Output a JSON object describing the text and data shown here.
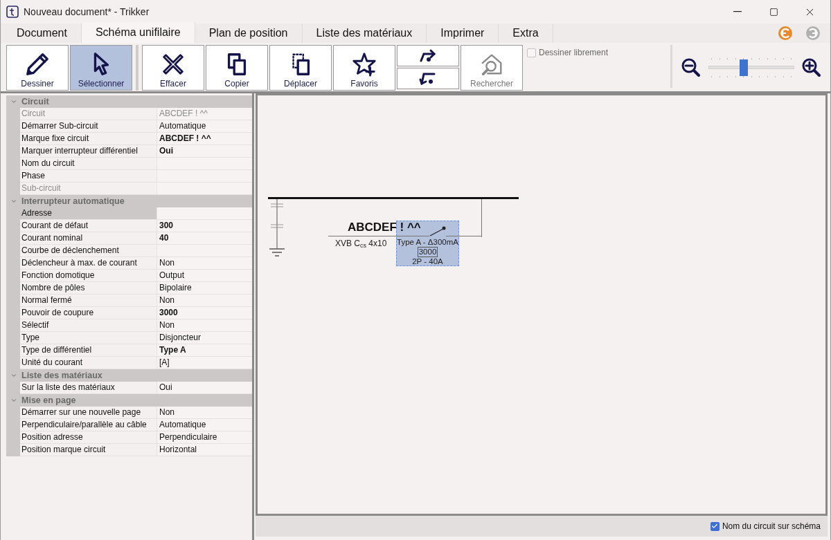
{
  "window": {
    "title": "Nouveau document* - Trikker"
  },
  "tabs": [
    {
      "label": "Document",
      "selected": false
    },
    {
      "label": "Schéma unifilaire",
      "selected": true
    },
    {
      "label": "Plan de position",
      "selected": false
    },
    {
      "label": "Liste des matériaux",
      "selected": false
    },
    {
      "label": "Imprimer",
      "selected": false
    },
    {
      "label": "Extra",
      "selected": false
    }
  ],
  "history": [
    {
      "kind": "undo",
      "disabled": false
    },
    {
      "kind": "redo",
      "disabled": true
    }
  ],
  "toolbar": {
    "buttons": [
      {
        "kind": "draw",
        "label": "Dessiner",
        "selected": false,
        "disabled": false
      },
      {
        "kind": "select",
        "label": "Sélectionner",
        "selected": true,
        "disabled": false
      },
      {
        "kind": "separator"
      },
      {
        "kind": "erase",
        "label": "Effacer",
        "selected": false,
        "disabled": false
      },
      {
        "kind": "copy",
        "label": "Copier",
        "selected": false,
        "disabled": false
      },
      {
        "kind": "move",
        "label": "Déplacer",
        "selected": false,
        "disabled": false
      },
      {
        "kind": "favorites",
        "label": "Favoris",
        "selected": false,
        "disabled": false
      },
      {
        "kind": "steps"
      },
      {
        "kind": "search",
        "label": "Rechercher",
        "selected": false,
        "disabled": true
      }
    ],
    "free_draw": {
      "label": "Dessiner librement",
      "checked": false
    },
    "zoom": {
      "level": 0.41
    }
  },
  "properties": [
    {
      "title": "Circuit",
      "expanded": true,
      "rows": [
        {
          "label": "Circuit",
          "value": "ABCDEF ! ^^",
          "disabled": true,
          "bold": false,
          "selected": false
        },
        {
          "label": "Démarrer Sub-circuit",
          "value": "Automatique",
          "disabled": false,
          "bold": false,
          "selected": false
        },
        {
          "label": "Marque fixe circuit",
          "value": "ABCDEF ! ^^",
          "disabled": false,
          "bold": true,
          "selected": false
        },
        {
          "label": "Marquer  interrupteur différentiel",
          "value": "Oui",
          "disabled": false,
          "bold": true,
          "selected": false
        },
        {
          "label": "Nom du circuit",
          "disabled": false,
          "selected": false
        },
        {
          "label": "Phase",
          "disabled": false,
          "selected": false
        },
        {
          "label": "Sub-circuit",
          "disabled": true,
          "selected": false
        }
      ]
    },
    {
      "title": "Interrupteur automatique",
      "expanded": true,
      "rows": [
        {
          "label": "Adresse",
          "disabled": false,
          "selected": true
        },
        {
          "label": "Courant de défaut",
          "value": "300",
          "disabled": false,
          "bold": true,
          "selected": false
        },
        {
          "label": "Courant nominal",
          "value": "40",
          "disabled": false,
          "bold": true,
          "selected": false
        },
        {
          "label": "Courbe de déclenchement",
          "disabled": false,
          "selected": false
        },
        {
          "label": "Déclencheur à max. de courant",
          "value": "Non",
          "disabled": false,
          "bold": false,
          "selected": false
        },
        {
          "label": "Fonction domotique",
          "value": "Output",
          "disabled": false,
          "bold": false,
          "selected": false
        },
        {
          "label": "Nombre de pôles",
          "value": "Bipolaire",
          "disabled": false,
          "bold": false,
          "selected": false
        },
        {
          "label": "Normal fermé",
          "value": "Non",
          "disabled": false,
          "bold": false,
          "selected": false
        },
        {
          "label": "Pouvoir de coupure",
          "value": "3000",
          "disabled": false,
          "bold": true,
          "selected": false
        },
        {
          "label": "Sélectif",
          "value": "Non",
          "disabled": false,
          "bold": false,
          "selected": false
        },
        {
          "label": "Type",
          "value": "Disjoncteur",
          "disabled": false,
          "bold": false,
          "selected": false
        },
        {
          "label": "Type de différentiel",
          "value": "Type A",
          "disabled": false,
          "bold": true,
          "selected": false
        },
        {
          "label": "Unité du courant",
          "value": "[A]",
          "disabled": false,
          "bold": false,
          "selected": false
        }
      ]
    },
    {
      "title": "Liste des matériaux",
      "expanded": true,
      "rows": [
        {
          "label": "Sur la liste des matériaux",
          "value": "Oui",
          "disabled": false,
          "bold": false,
          "selected": false
        }
      ]
    },
    {
      "title": "Mise en page",
      "expanded": true,
      "rows": [
        {
          "label": "Démarrer sur une nouvelle page",
          "value": "Non",
          "disabled": false,
          "bold": false,
          "selected": false
        },
        {
          "label": "Perpendiculaire/parallèle au câble",
          "value": "Automatique",
          "disabled": false,
          "bold": false,
          "selected": false
        },
        {
          "label": "Position adresse",
          "value": "Perpendiculaire",
          "disabled": false,
          "bold": false,
          "selected": false
        },
        {
          "label": "Position marque circuit",
          "value": "Horizontal",
          "disabled": false,
          "bold": false,
          "selected": false
        }
      ]
    }
  ],
  "schematic": {
    "circuit_mark": "ABCDEF ! ^^",
    "cable": "XVB C$_{cs}$ 4x10",
    "breaker": {
      "selected": true,
      "lines": [
        {
          "text": "Type A - Δ300mA",
          "boxed": false
        },
        {
          "text": "3000",
          "boxed": true
        },
        {
          "text": "2P - 40A",
          "boxed": false
        }
      ]
    }
  },
  "status_bar": {
    "option": {
      "label": "Nom du circuit sur schéma",
      "checked": true
    }
  }
}
